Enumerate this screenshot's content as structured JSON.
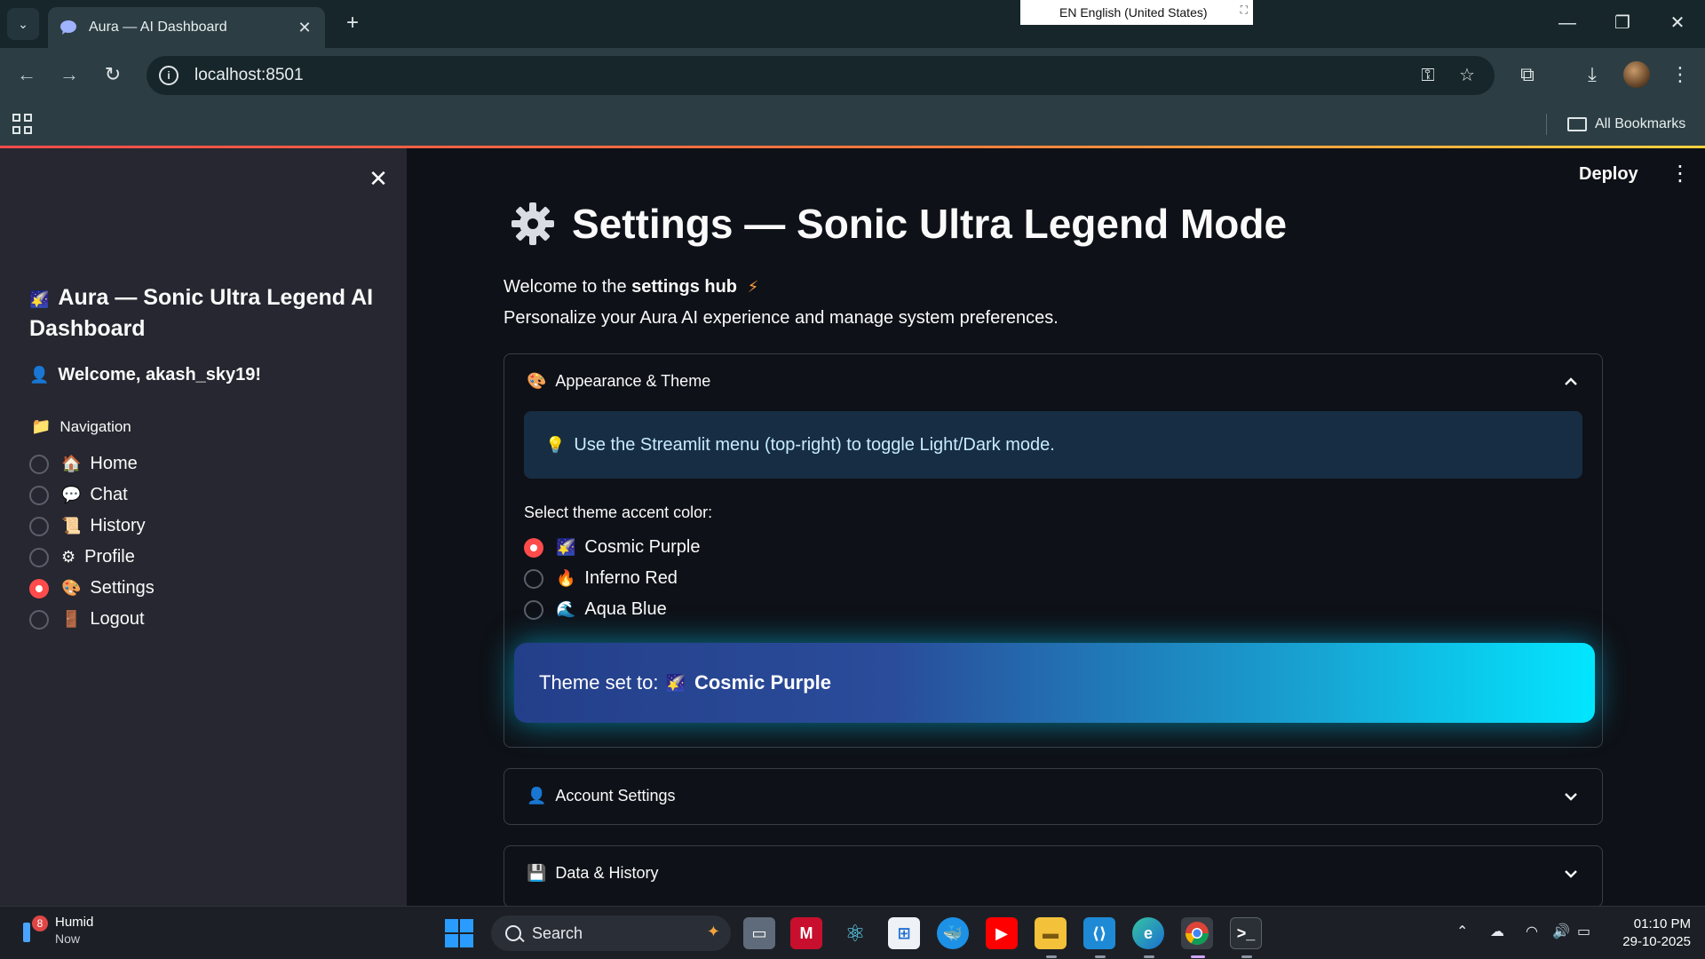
{
  "browser": {
    "tab_title": "Aura — AI Dashboard",
    "new_tab_icon": "plus-icon",
    "url": "localhost:8501",
    "language_indicator": "EN English (United States)",
    "all_bookmarks_label": "All Bookmarks"
  },
  "app": {
    "deploy_label": "Deploy",
    "sidebar": {
      "title_emoji": "🌠",
      "title": "Aura — Sonic Ultra Legend AI Dashboard",
      "welcome_emoji": "👤",
      "welcome": "Welcome, akash_sky19!",
      "nav_emoji": "📁",
      "nav_label": "Navigation",
      "nav_items": [
        {
          "emoji": "🏠",
          "label": "Home",
          "selected": false
        },
        {
          "emoji": "💬",
          "label": "Chat",
          "selected": false
        },
        {
          "emoji": "📜",
          "label": "History",
          "selected": false
        },
        {
          "emoji": "⚙",
          "label": "Profile",
          "selected": false
        },
        {
          "emoji": "🎨",
          "label": "Settings",
          "selected": true
        },
        {
          "emoji": "🚪",
          "label": "Logout",
          "selected": false
        }
      ]
    },
    "main": {
      "title": "Settings — Sonic Ultra Legend Mode",
      "intro_prefix": "Welcome to the ",
      "intro_bold": "settings hub",
      "intro_emoji": "⚡",
      "intro_line2": "Personalize your Aura AI experience and manage system preferences.",
      "appearance": {
        "emoji": "🎨",
        "header": "Appearance & Theme",
        "expanded": true,
        "info_emoji": "💡",
        "info": "Use the Streamlit menu (top-right) to toggle Light/Dark mode.",
        "accent_label": "Select theme accent color:",
        "options": [
          {
            "emoji": "🌠",
            "label": "Cosmic Purple",
            "selected": true
          },
          {
            "emoji": "🔥",
            "label": "Inferno Red",
            "selected": false
          },
          {
            "emoji": "🌊",
            "label": "Aqua Blue",
            "selected": false
          }
        ],
        "result_prefix": "Theme set to:",
        "result_emoji": "🌠",
        "result_value": "Cosmic Purple"
      },
      "account": {
        "emoji": "👤",
        "header": "Account Settings",
        "expanded": false
      },
      "data_history": {
        "emoji": "💾",
        "header": "Data & History",
        "expanded": false
      }
    }
  },
  "taskbar": {
    "weather_badge": "8",
    "weather_title": "Humid",
    "weather_sub": "Now",
    "search_placeholder": "Search",
    "time": "01:10 PM",
    "date": "29-10-2025"
  },
  "colors": {
    "accent": "#ff4b4b",
    "app_bg": "#0e1117",
    "sidebar_bg": "#262730",
    "info_bg": "#172d43",
    "banner_gradient_start": "#243f8a",
    "banner_gradient_end": "#02e6ff"
  }
}
